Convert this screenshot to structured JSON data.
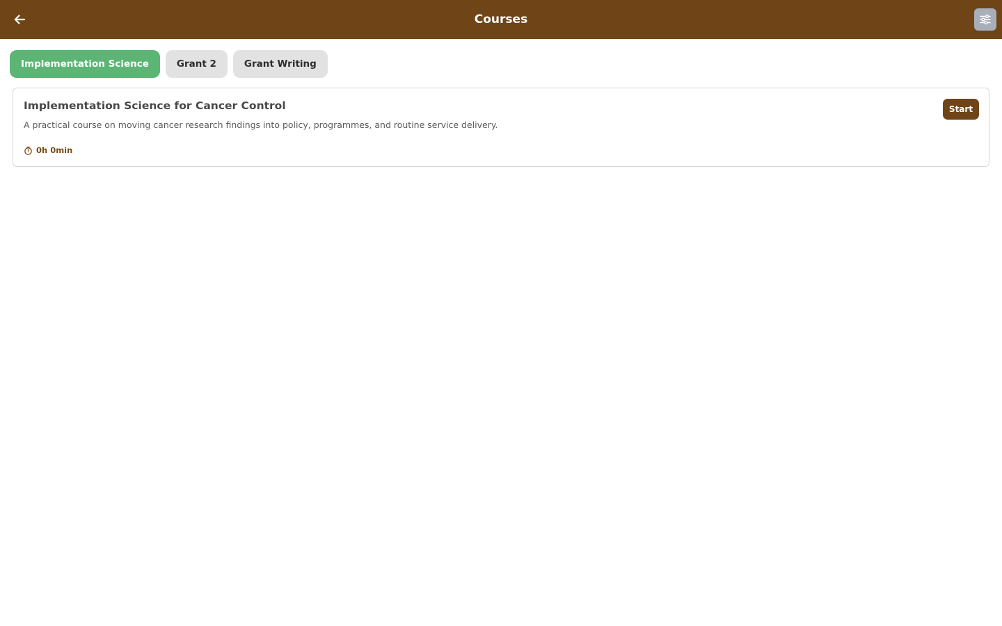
{
  "header": {
    "title": "Courses",
    "back_icon": "arrow-left-icon",
    "filter_icon": "sliders-icon"
  },
  "tabs": [
    {
      "label": "Implementation Science",
      "active": true
    },
    {
      "label": "Grant 2",
      "active": false
    },
    {
      "label": "Grant Writing",
      "active": false
    }
  ],
  "courses": [
    {
      "title": "Implementation Science for Cancer Control",
      "description": "A practical course on moving cancer research findings into policy, programmes, and routine service delivery.",
      "duration": "0h 0min",
      "duration_icon": "stopwatch-icon",
      "action_label": "Start"
    }
  ],
  "colors": {
    "brand": "#6f4518",
    "active_tab": "#5cb574",
    "inactive_tab": "#e2e2e2",
    "filter_button": "#a9aebb"
  }
}
